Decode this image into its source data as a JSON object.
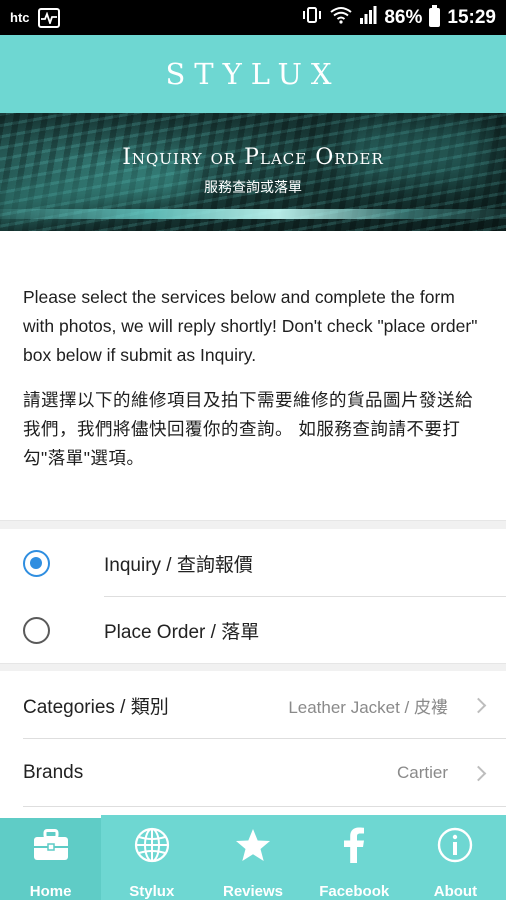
{
  "status_bar": {
    "carrier": "htc",
    "battery": "86%",
    "time": "15:29"
  },
  "header": {
    "brand": "STYLUX"
  },
  "banner": {
    "title": "Inquiry or Place Order",
    "subtitle": "服務查詢或落單"
  },
  "intro": {
    "english": "Please select the services below and complete the form with photos, we will reply shortly! Don't check \"place order\" box below if submit as Inquiry.",
    "chinese": "請選擇以下的維修項目及拍下需要維修的貨品圖片發送給我們，我們將儘快回覆你的查詢。 如服務查詢請不要打勾\"落單\"選項。"
  },
  "options": [
    {
      "label": "Inquiry / 查詢報價",
      "selected": true
    },
    {
      "label": "Place Order / 落單",
      "selected": false
    }
  ],
  "form": {
    "categories_label": "Categories / 類別",
    "categories_value": "Leather Jacket / 皮褸",
    "brands_label": "Brands",
    "brands_value": "Cartier"
  },
  "tabs": [
    {
      "label": "Home",
      "icon": "briefcase-icon",
      "active": true
    },
    {
      "label": "Stylux",
      "icon": "globe-icon",
      "active": false
    },
    {
      "label": "Reviews",
      "icon": "star-icon",
      "active": false
    },
    {
      "label": "Facebook",
      "icon": "facebook-icon",
      "active": false
    },
    {
      "label": "About",
      "icon": "info-icon",
      "active": false
    }
  ],
  "colors": {
    "accent": "#6ed7d2",
    "radio_selected": "#2f8ee0"
  }
}
